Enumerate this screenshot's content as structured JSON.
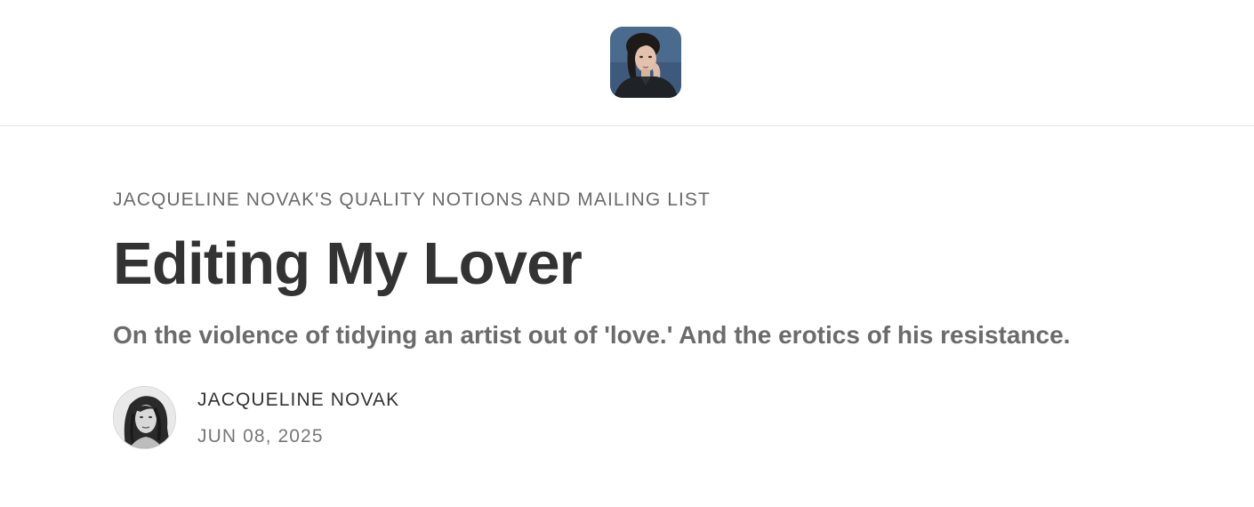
{
  "header": {
    "logo_icon": "publication-logo-portrait"
  },
  "article": {
    "publication_name": "JACQUELINE NOVAK'S QUALITY NOTIONS AND MAILING LIST",
    "title": "Editing My Lover",
    "subtitle": "On the violence of tidying an artist out of 'love.' And the erotics of his resistance.",
    "author": {
      "avatar_icon": "author-avatar-portrait",
      "name": "JACQUELINE NOVAK",
      "date": "JUN 08, 2025"
    }
  },
  "colors": {
    "title": "#333333",
    "muted_text": "#6b6b6b",
    "divider": "#e2e2e2",
    "logo_background": "#4a6a8e"
  }
}
